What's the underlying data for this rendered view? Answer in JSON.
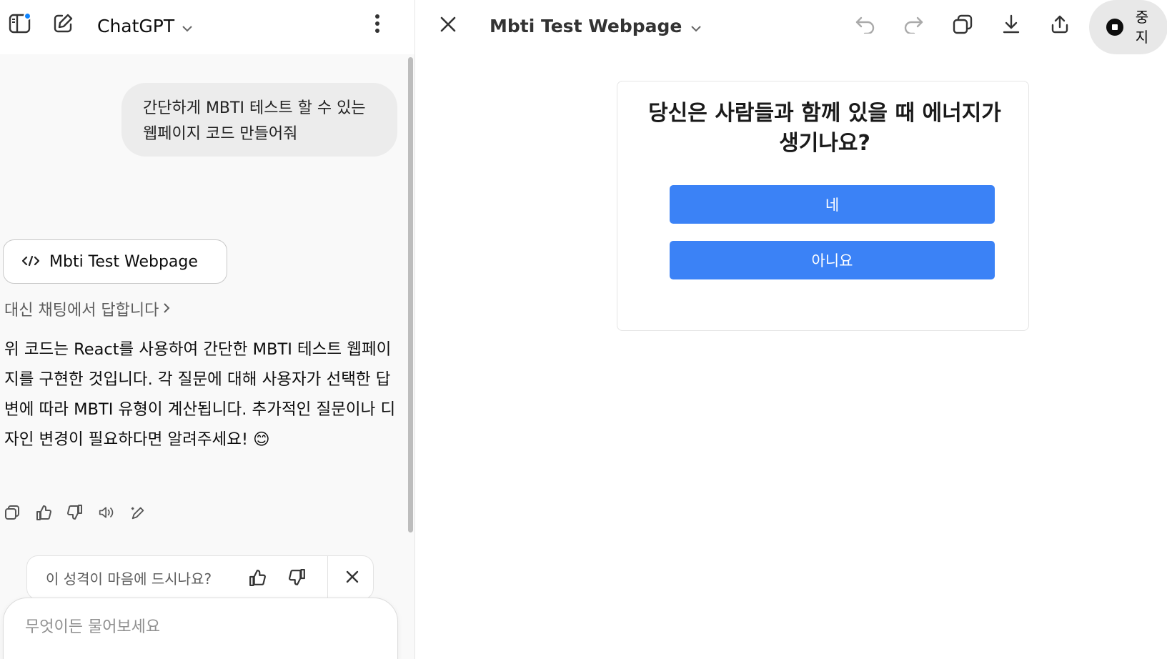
{
  "left_header": {
    "model_name": "ChatGPT",
    "icons": {
      "sidebar": "sidebar-toggle-icon",
      "new_chat": "new-chat-icon",
      "more": "more-vertical-icon",
      "chevron": "chevron-down-icon"
    }
  },
  "chat": {
    "user_message": "간단하게 MBTI 테스트 할 수 있는 웹페이지 코드 만들어줘",
    "artifact_label": "Mbti Test Webpage",
    "reply_link": "대신 채팅에서 답합니다",
    "assistant_message": "위 코드는 React를 사용하여 간단한 MBTI 테스트 웹페이지를 구현한 것입니다. 각 질문에 대해 사용자가 선택한 답변에 따라 MBTI 유형이 계산됩니다. 추가적인 질문이나 디자인 변경이 필요하다면 알려주세요! 😊",
    "action_icons": [
      "copy-icon",
      "thumbs-up-icon",
      "thumbs-down-icon",
      "read-aloud-icon",
      "edit-sparkle-icon"
    ]
  },
  "feedback": {
    "prompt": "이 성격이 마음에 드시나요?"
  },
  "composer": {
    "placeholder": "무엇이든 물어보세요"
  },
  "canvas": {
    "title": "Mbti Test Webpage",
    "stop_label": "중지",
    "tool_icons": [
      "undo-icon",
      "redo-icon",
      "copy-icon",
      "download-icon",
      "share-icon"
    ],
    "question": "당신은 사람들과 함께 있을 때 에너지가 생기나요?",
    "answers": {
      "yes": "네",
      "no": "아니요"
    }
  },
  "colors": {
    "accent": "#3b82f6",
    "notification": "#0f85ff"
  }
}
